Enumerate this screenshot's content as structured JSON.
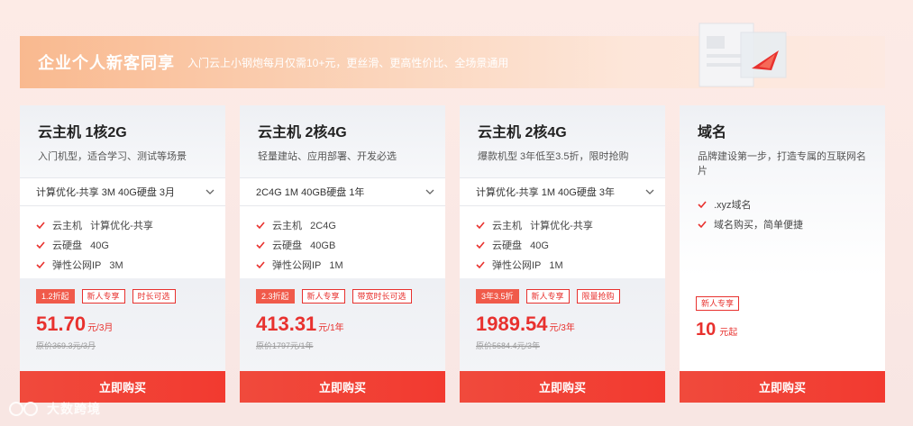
{
  "banner": {
    "title": "企业个人新客同享",
    "subtitle": "入门云上小钢炮每月仅需10+元，更丝滑、更高性价比、全场景通用"
  },
  "cards": [
    {
      "title": "云主机 1核2G",
      "desc": "入门机型，适合学习、测试等场景",
      "select": "计算优化-共享 3M 40G硬盘 3月",
      "features": [
        "云主机   计算优化-共享",
        "云硬盘   40G",
        "弹性公网IP   3M"
      ],
      "tags": [
        "1.2折起",
        "新人专享",
        "时长可选"
      ],
      "price": "51.70",
      "unit": "元/3月",
      "original": "原价369.3元/3月",
      "buy": "立即购买"
    },
    {
      "title": "云主机 2核4G",
      "desc": "轻量建站、应用部署、开发必选",
      "select": "2C4G 1M 40GB硬盘 1年",
      "features": [
        "云主机   2C4G",
        "云硬盘   40GB",
        "弹性公网IP   1M"
      ],
      "tags": [
        "2.3折起",
        "新人专享",
        "带宽时长可选"
      ],
      "price": "413.31",
      "unit": "元/1年",
      "original": "原价1797元/1年",
      "buy": "立即购买"
    },
    {
      "title": "云主机 2核4G",
      "desc": "爆款机型 3年低至3.5折，限时抢购",
      "select": "计算优化-共享 1M 40G硬盘 3年",
      "features": [
        "云主机   计算优化-共享",
        "云硬盘   40G",
        "弹性公网IP   1M"
      ],
      "tags": [
        "3年3.5折",
        "新人专享",
        "限量抢购"
      ],
      "price": "1989.54",
      "unit": "元/3年",
      "original": "原价5684.4元/3年",
      "buy": "立即购买"
    },
    {
      "title": "域名",
      "desc": "品牌建设第一步，打造专属的互联网名片",
      "features": [
        ".xyz域名",
        "域名购买，简单便捷"
      ],
      "tags": [
        "新人专享"
      ],
      "price": "10",
      "unit": "元起",
      "buy": "立即购买"
    }
  ],
  "watermark": "大数跨境",
  "colors": {
    "accent": "#e8312e",
    "banner": "#f9b98f"
  }
}
